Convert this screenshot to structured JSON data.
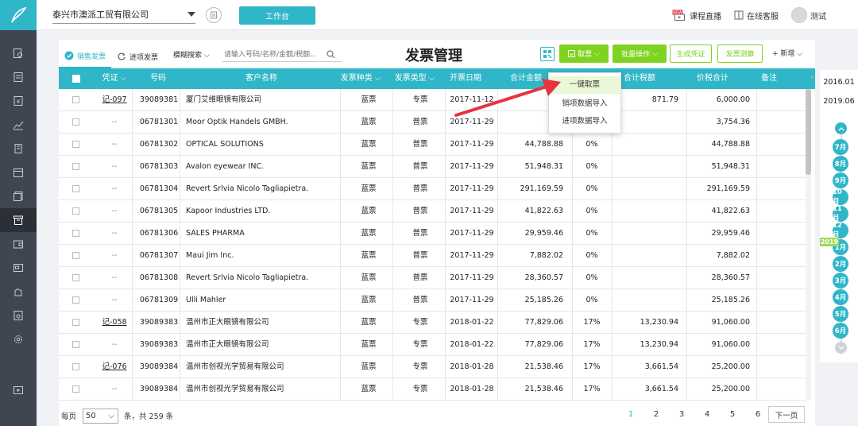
{
  "topbar": {
    "company": "泰兴市澳派工贸有限公司",
    "workbench_label": "工作台",
    "live_label": "课程直播",
    "live_badge": "NEW",
    "support_label": "在线客服",
    "user_label": "测试"
  },
  "toolbar": {
    "tab_sales": "销售发票",
    "tab_purchase": "进项发票",
    "search_mode": "模糊搜索",
    "search_placeholder": "请输入号码/名称/金额/税额...",
    "title": "发票管理",
    "fetch_label": "取票",
    "batch_label": "批量操作",
    "voucher_label": "生成凭证",
    "calc_label": "发票测算",
    "add_label": "新增"
  },
  "dropdown": {
    "items": [
      "一键取票",
      "销项数据导入",
      "进项数据导入"
    ]
  },
  "table": {
    "headers": {
      "voucher": "凭证",
      "number": "号码",
      "customer": "客户名称",
      "kind": "发票种类",
      "type": "发票类型",
      "date": "开票日期",
      "amount": "合计金额",
      "tax_rate": "",
      "tax": "合计税额",
      "total": "价税合计",
      "note": "备注"
    },
    "rows": [
      {
        "voucher": "记-097",
        "number": "39089381",
        "customer": "厦门艾维眼镜有限公司",
        "kind": "蓝票",
        "type": "专票",
        "date": "2017-11-12",
        "amount": "5,1",
        "rate": "",
        "tax": "871.79",
        "total": "6,000.00"
      },
      {
        "voucher": "--",
        "number": "06781301",
        "customer": "Moor Optik Handels GMBH.",
        "kind": "蓝票",
        "type": "普票",
        "date": "2017-11-29",
        "amount": "3,7",
        "rate": "",
        "tax": "",
        "total": "3,754.36"
      },
      {
        "voucher": "--",
        "number": "06781302",
        "customer": "OPTICAL SOLUTIONS",
        "kind": "蓝票",
        "type": "普票",
        "date": "2017-11-29",
        "amount": "44,788.88",
        "rate": "0%",
        "tax": "",
        "total": "44,788.88"
      },
      {
        "voucher": "--",
        "number": "06781303",
        "customer": "Avalon eyewear INC.",
        "kind": "蓝票",
        "type": "普票",
        "date": "2017-11-29",
        "amount": "51,948.31",
        "rate": "0%",
        "tax": "",
        "total": "51,948.31"
      },
      {
        "voucher": "--",
        "number": "06781304",
        "customer": "Revert Srlvia Nicolo Tagliapietra.",
        "kind": "蓝票",
        "type": "普票",
        "date": "2017-11-29",
        "amount": "291,169.59",
        "rate": "0%",
        "tax": "",
        "total": "291,169.59"
      },
      {
        "voucher": "--",
        "number": "06781305",
        "customer": "Kapoor Industries LTD.",
        "kind": "蓝票",
        "type": "普票",
        "date": "2017-11-29",
        "amount": "41,822.63",
        "rate": "0%",
        "tax": "",
        "total": "41,822.63"
      },
      {
        "voucher": "--",
        "number": "06781306",
        "customer": "SALES PHARMA",
        "kind": "蓝票",
        "type": "普票",
        "date": "2017-11-29",
        "amount": "29,959.46",
        "rate": "0%",
        "tax": "",
        "total": "29,959.46"
      },
      {
        "voucher": "--",
        "number": "06781307",
        "customer": "Maui Jim Inc.",
        "kind": "蓝票",
        "type": "普票",
        "date": "2017-11-29",
        "amount": "7,882.02",
        "rate": "0%",
        "tax": "",
        "total": "7,882.02"
      },
      {
        "voucher": "--",
        "number": "06781308",
        "customer": "Revert Srlvia Nicolo Tagliapietra.",
        "kind": "蓝票",
        "type": "普票",
        "date": "2017-11-29",
        "amount": "28,360.57",
        "rate": "0%",
        "tax": "",
        "total": "28,360.57"
      },
      {
        "voucher": "--",
        "number": "06781309",
        "customer": "Ulli Mahler",
        "kind": "蓝票",
        "type": "普票",
        "date": "2017-11-29",
        "amount": "25,185.26",
        "rate": "0%",
        "tax": "",
        "total": "25,185.26"
      },
      {
        "voucher": "记-058",
        "number": "39089383",
        "customer": "温州市正大眼镜有限公司",
        "kind": "蓝票",
        "type": "专票",
        "date": "2018-01-22",
        "amount": "77,829.06",
        "rate": "17%",
        "tax": "13,230.94",
        "total": "91,060.00"
      },
      {
        "voucher": "--",
        "number": "39089383",
        "customer": "温州市正大眼镜有限公司",
        "kind": "蓝票",
        "type": "专票",
        "date": "2018-01-22",
        "amount": "77,829.06",
        "rate": "17%",
        "tax": "13,230.94",
        "total": "91,060.00"
      },
      {
        "voucher": "记-076",
        "number": "39089384",
        "customer": "温州市创视光学贸易有限公司",
        "kind": "蓝票",
        "type": "专票",
        "date": "2018-01-28",
        "amount": "21,538.46",
        "rate": "17%",
        "tax": "3,661.54",
        "total": "25,200.00"
      },
      {
        "voucher": "--",
        "number": "39089384",
        "customer": "温州市创视光学贸易有限公司",
        "kind": "蓝票",
        "type": "专票",
        "date": "2018-01-28",
        "amount": "21,538.46",
        "rate": "17%",
        "tax": "3,661.54",
        "total": "25,200.00"
      }
    ]
  },
  "footer": {
    "per_page": "每页",
    "page_size": "50",
    "total_text": "条，共 259 条",
    "pages": [
      "1",
      "2",
      "3",
      "4",
      "5",
      "6"
    ],
    "current_page": "1",
    "next_label": "下一页"
  },
  "timeline": {
    "start_date": "2016.01",
    "end_date": "2019.06",
    "year_badge": "2019",
    "months": [
      "7月",
      "8月",
      "9月",
      "10月",
      "11月",
      "12月",
      "1月",
      "2月",
      "3月",
      "4月",
      "5月",
      "6月"
    ]
  },
  "colors": {
    "accent": "#2fb6c8",
    "green": "#7ed321",
    "sidebar": "#3f4651",
    "arrow": "#e8333f"
  }
}
